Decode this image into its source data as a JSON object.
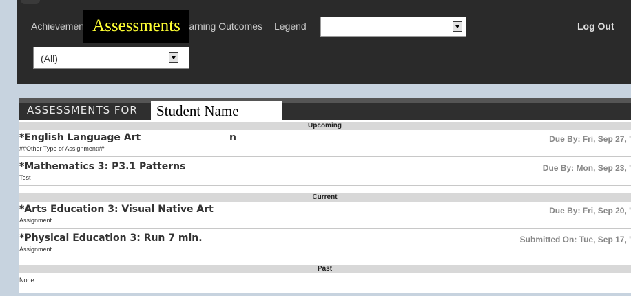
{
  "nav": {
    "achievement": "Achievement",
    "assessments": "Assessments",
    "learning_outcomes": "Learning Outcomes",
    "legend": "Legend",
    "student_select_value": "",
    "logout": "Log Out",
    "filter_value": "(All)"
  },
  "panel": {
    "header_label": "ASSESSMENTS FOR",
    "student_name": "Student Name"
  },
  "sections": {
    "upcoming": "Upcoming",
    "current": "Current",
    "past": "Past"
  },
  "assignments": [
    {
      "title": "*English Language Art",
      "extra": "n",
      "type": "##Other Type of Assignment##",
      "date": "Due By: Fri, Sep 27, '"
    },
    {
      "title": "*Mathematics 3:  P3.1 Patterns",
      "extra": "",
      "type": "Test",
      "date": "Due By: Mon, Sep 23, '"
    },
    {
      "title": "*Arts Education 3:  Visual Native Art",
      "extra": "",
      "type": "Assignment",
      "date": "Due By: Fri, Sep 20, '"
    },
    {
      "title": "*Physical Education 3:  Run 7 min.",
      "extra": "",
      "type": "Assignment",
      "date": "Submitted On: Tue, Sep 17, '"
    }
  ],
  "past_none": "None"
}
